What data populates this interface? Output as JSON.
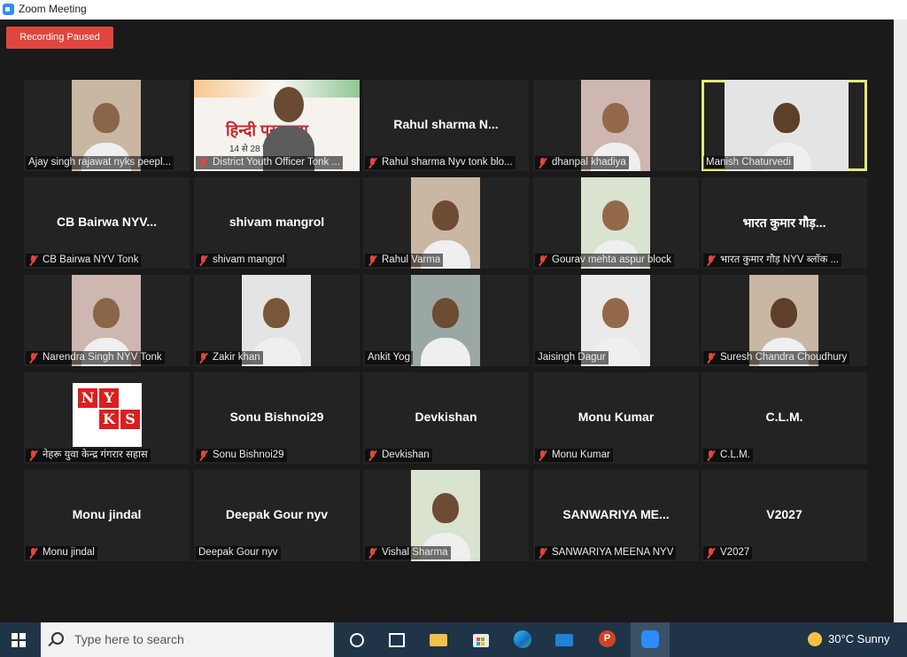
{
  "window": {
    "title": "Zoom Meeting"
  },
  "recording": {
    "label": "Recording Paused"
  },
  "tiles": [
    {
      "label": "Ajay singh rajawat nyks peepl...",
      "muted": false,
      "video": true,
      "big": ""
    },
    {
      "label": "District Youth Officer Tonk ...",
      "muted": true,
      "video": true,
      "big": ""
    },
    {
      "label": "Rahul sharma Nyv tonk blo...",
      "muted": true,
      "video": false,
      "big": "Rahul sharma N..."
    },
    {
      "label": "dhanpal khadiya",
      "muted": true,
      "video": true,
      "big": ""
    },
    {
      "label": "Manish Chaturvedi",
      "muted": false,
      "video": true,
      "big": "",
      "active": true
    },
    {
      "label": "CB Bairwa NYV Tonk",
      "muted": true,
      "video": false,
      "big": "CB Bairwa NYV..."
    },
    {
      "label": "shivam mangrol",
      "muted": true,
      "video": false,
      "big": "shivam mangrol"
    },
    {
      "label": "Rahul Varma",
      "muted": true,
      "video": true,
      "big": ""
    },
    {
      "label": "Gourav mehta aspur block",
      "muted": true,
      "video": true,
      "big": ""
    },
    {
      "label": "भारत कुमार गौड़ NYV ब्लॉक ...",
      "muted": true,
      "video": false,
      "big": "भारत कुमार गौड़..."
    },
    {
      "label": "Narendra Singh NYV Tonk",
      "muted": true,
      "video": true,
      "big": ""
    },
    {
      "label": "Zakir khan",
      "muted": true,
      "video": true,
      "big": ""
    },
    {
      "label": "Ankit Yog",
      "muted": false,
      "video": true,
      "big": ""
    },
    {
      "label": "Jaisingh Dagur",
      "muted": false,
      "video": true,
      "big": ""
    },
    {
      "label": "Suresh Chandra Choudhury",
      "muted": true,
      "video": true,
      "big": ""
    },
    {
      "label": "नेहरू युवा केन्द्र गंगरार सहास",
      "muted": true,
      "video": true,
      "big": "",
      "nyks": true
    },
    {
      "label": "Sonu Bishnoi29",
      "muted": true,
      "video": false,
      "big": "Sonu Bishnoi29"
    },
    {
      "label": "Devkishan",
      "muted": true,
      "video": false,
      "big": "Devkishan"
    },
    {
      "label": "Monu Kumar",
      "muted": true,
      "video": false,
      "big": "Monu Kumar"
    },
    {
      "label": "C.L.M.",
      "muted": true,
      "video": false,
      "big": "C.L.M."
    },
    {
      "label": "Monu jindal",
      "muted": true,
      "video": false,
      "big": "Monu jindal"
    },
    {
      "label": "Deepak Gour nyv",
      "muted": false,
      "video": false,
      "big": "Deepak Gour nyv"
    },
    {
      "label": "Vishal Sharma",
      "muted": true,
      "video": true,
      "big": ""
    },
    {
      "label": "SANWARIYA MEENA NYV",
      "muted": true,
      "video": false,
      "big": "SANWARIYA ME..."
    },
    {
      "label": "V2027",
      "muted": true,
      "video": false,
      "big": "V2027"
    }
  ],
  "banner": {
    "heading": "हिन्दी पखवाड़ा",
    "dates": "14 से 28 सितम्बर 2021"
  },
  "nyks_logo": {
    "letters": [
      "N",
      "Y",
      "K",
      "S"
    ]
  },
  "taskbar": {
    "search_placeholder": "Type here to search",
    "weather": "30°C  Sunny",
    "icons": [
      "start-icon",
      "task-view-icon",
      "widgets-icon",
      "file-explorer-icon",
      "store-icon",
      "edge-icon",
      "mail-icon",
      "powerpoint-icon",
      "zoom-icon"
    ]
  },
  "colors": {
    "active_speaker": "#e4e87a",
    "record": "#e0463e",
    "taskbar": "#203448"
  }
}
